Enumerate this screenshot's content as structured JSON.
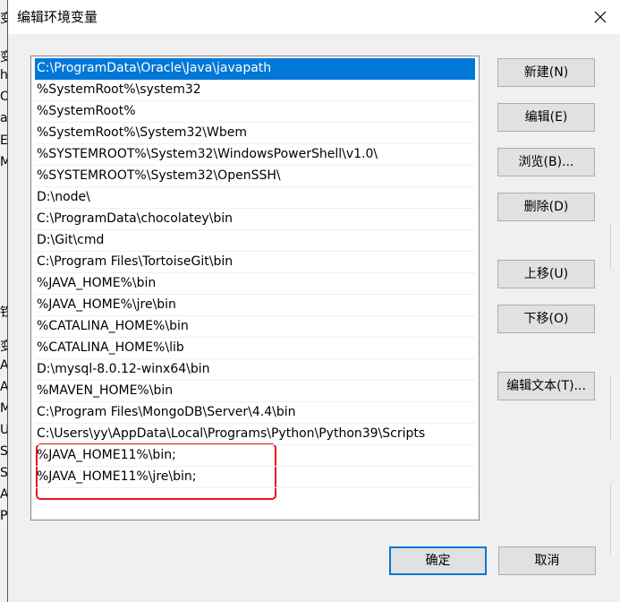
{
  "dialog": {
    "title": "编辑环境变量"
  },
  "path_entries": [
    "C:\\ProgramData\\Oracle\\Java\\javapath",
    "%SystemRoot%\\system32",
    "%SystemRoot%",
    "%SystemRoot%\\System32\\Wbem",
    "%SYSTEMROOT%\\System32\\WindowsPowerShell\\v1.0\\",
    "%SYSTEMROOT%\\System32\\OpenSSH\\",
    "D:\\node\\",
    "C:\\ProgramData\\chocolatey\\bin",
    "D:\\Git\\cmd",
    "C:\\Program Files\\TortoiseGit\\bin",
    "%JAVA_HOME%\\bin",
    "%JAVA_HOME%\\jre\\bin",
    "%CATALINA_HOME%\\bin",
    "%CATALINA_HOME%\\lib",
    "D:\\mysql-8.0.12-winx64\\bin",
    "%MAVEN_HOME%\\bin",
    "C:\\Program Files\\MongoDB\\Server\\4.4\\bin",
    "C:\\Users\\yy\\AppData\\Local\\Programs\\Python\\Python39\\Scripts",
    "%JAVA_HOME11%\\bin;",
    "%JAVA_HOME11%\\jre\\bin;"
  ],
  "selected_index": 0,
  "buttons": {
    "new": "新建(N)",
    "edit": "编辑(E)",
    "browse": "浏览(B)...",
    "delete": "删除(D)",
    "move_up": "上移(U)",
    "move_down": "下移(O)",
    "edit_text": "编辑文本(T)...",
    "ok": "确定",
    "cancel": "取消"
  },
  "background_fragments": [
    "变",
    "h",
    "Or",
    "a",
    "E",
    "M",
    "铁",
    "变",
    "A",
    "A",
    "M",
    "U",
    "S",
    "S",
    "A",
    "P"
  ],
  "colors": {
    "selection": "#0078d7",
    "annotation": "#e8171b",
    "dialog_bg": "#f0f0f0"
  },
  "icons": {
    "close": "close-icon"
  }
}
